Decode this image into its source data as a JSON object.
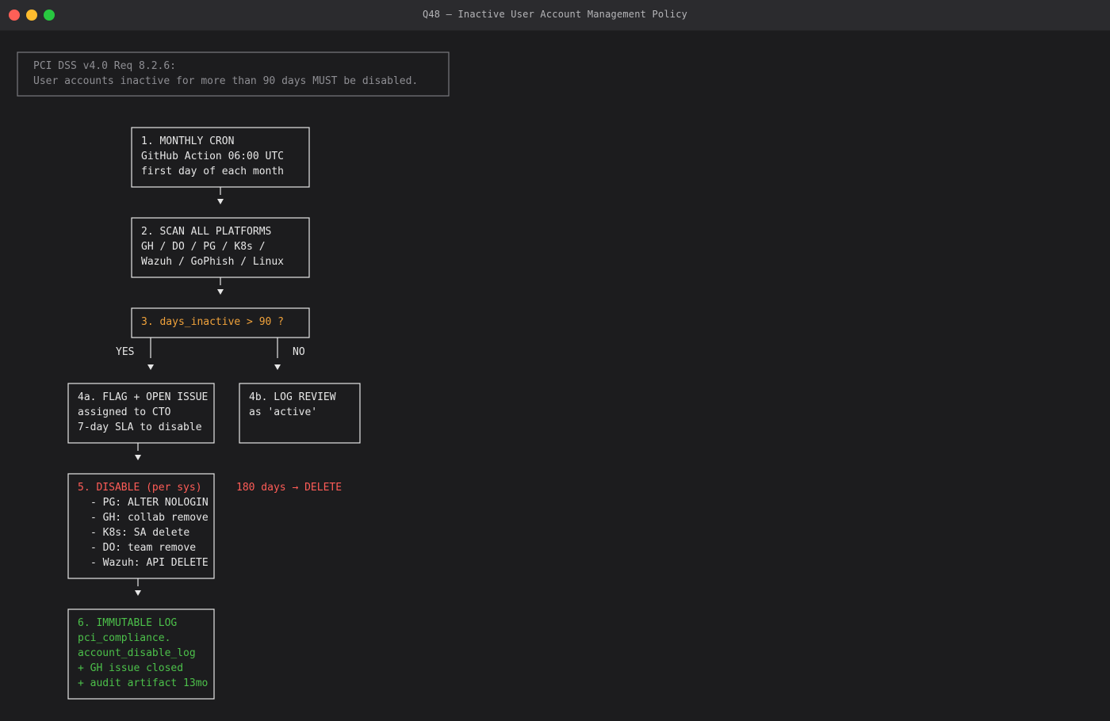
{
  "colors": {
    "background": "#1c1c1e",
    "titlebar": "#2b2b2e",
    "box_default": "#e6e6e6",
    "note": "#8e8e93",
    "decision": "#f0a23b",
    "disable": "#ff5c57",
    "log": "#4cc04a"
  },
  "window": {
    "title": "Q48 — Inactive User Account Management Policy",
    "buttons": [
      "close",
      "minimize",
      "maximize"
    ]
  },
  "diagram": {
    "note": {
      "line1": "PCI DSS v4.0 Req 8.2.6:",
      "line2": "User accounts inactive for more than 90 days MUST be disabled."
    },
    "step1": {
      "title": "1. MONTHLY CRON",
      "line1": "GitHub Action 06:00 UTC",
      "line2": "first day of each month"
    },
    "step2": {
      "title": "2. SCAN ALL PLATFORMS",
      "line1": "GH / DO / PG / K8s /",
      "line2": "Wazuh / GoPhish / Linux"
    },
    "step3": {
      "title": "3. days_inactive > 90 ?"
    },
    "branch_yes": "YES",
    "branch_no": "NO",
    "step4a": {
      "title": "4a. FLAG + OPEN ISSUE",
      "line1": "assigned to CTO",
      "line2": "7-day SLA to disable"
    },
    "step4b": {
      "title": "4b. LOG REVIEW",
      "line1": "as 'active'"
    },
    "step5": {
      "title": "5. DISABLE (per sys)",
      "items": [
        "- PG: ALTER NOLOGIN",
        "- GH: collab remove",
        "- K8s: SA delete",
        "- DO: team remove",
        "- Wazuh: API DELETE"
      ]
    },
    "delete_note": "180 days → DELETE",
    "step6": {
      "title": "6. IMMUTABLE LOG",
      "line1": "pci_compliance.",
      "line2": "account_disable_log",
      "line3": "+ GH issue closed",
      "line4": "+ audit artifact 13mo"
    }
  }
}
